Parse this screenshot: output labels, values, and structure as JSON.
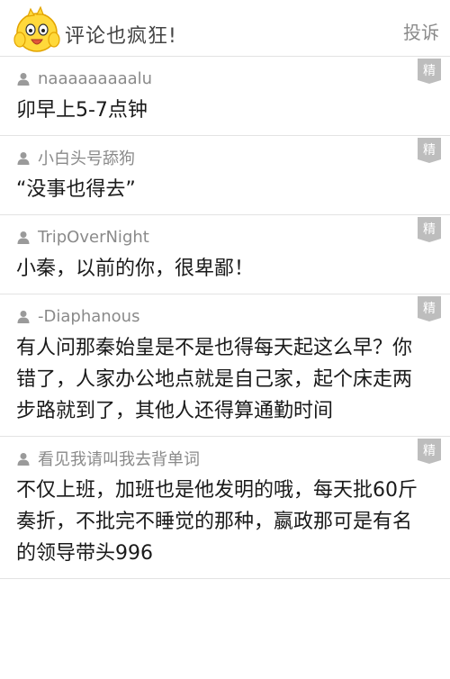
{
  "header": {
    "title": "评论也疯狂!",
    "report_label": "投诉"
  },
  "badge_label": "精",
  "comments": [
    {
      "user": "naaaaaaaaalu",
      "content": "卯早上5-7点钟"
    },
    {
      "user": "小白头号舔狗",
      "content": "“没事也得去”"
    },
    {
      "user": "TripOverNight",
      "content": "小秦，以前的你，很卑鄙！"
    },
    {
      "user": "-Diaphanous",
      "content": "有人问那秦始皇是不是也得每天起这么早？你错了，人家办公地点就是自己家，起个床走两步路就到了，其他人还得算通勤时间"
    },
    {
      "user": "看见我请叫我去背单词",
      "content": "不仅上班，加班也是他发明的哦，每天批60斤奏折，不批完不睡觉的那种，嬴政那可是有名的领导带头996"
    }
  ]
}
